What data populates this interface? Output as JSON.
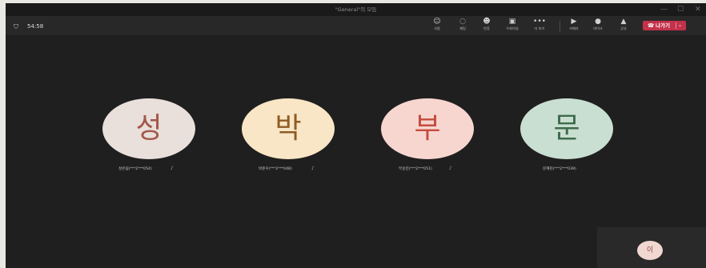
{
  "window": {
    "title": "\"General\"의 모임",
    "controls": {
      "minimize": "—",
      "maximize": "☐",
      "close": "✕"
    }
  },
  "toolbar": {
    "timer": "54:58",
    "buttons": [
      {
        "icon": "people-icon",
        "glyph": "☺",
        "label": "사람"
      },
      {
        "icon": "chat-icon",
        "glyph": "◌",
        "label": "채팅"
      },
      {
        "icon": "reactions-icon",
        "glyph": "☻",
        "label": "반응"
      },
      {
        "icon": "view-icon",
        "glyph": "▣",
        "label": "수회의실"
      },
      {
        "icon": "more-icon",
        "glyph": "•••",
        "label": "더 보기"
      },
      {
        "icon": "camera-icon",
        "glyph": "▶",
        "label": "카메라"
      },
      {
        "icon": "mic-icon",
        "glyph": "●",
        "label": "마이크"
      },
      {
        "icon": "share-icon",
        "glyph": "▲",
        "label": "공유"
      }
    ],
    "leave": {
      "label": "나가기",
      "icon": "phone-icon",
      "glyph": "☎",
      "chevron": "⌄",
      "color": "#c4314b"
    }
  },
  "participants": [
    {
      "initial": "성",
      "name": "성은림(***2***054)",
      "bg": "#e9dfdb",
      "fg": "#a25848",
      "muted": true
    },
    {
      "initial": "박",
      "name": "박준우(***2***048)",
      "bg": "#f8e6c6",
      "fg": "#915b23",
      "muted": true
    },
    {
      "initial": "부",
      "name": "부승민(***2***051)",
      "bg": "#f8d6d0",
      "fg": "#c54c3e",
      "muted": true
    },
    {
      "initial": "문",
      "name": "문혜린(***2***039)",
      "bg": "#c9dfd1",
      "fg": "#3e6b4d",
      "muted": false
    }
  ],
  "self_view": {
    "initial": "이",
    "bg": "#f0d7d2"
  }
}
